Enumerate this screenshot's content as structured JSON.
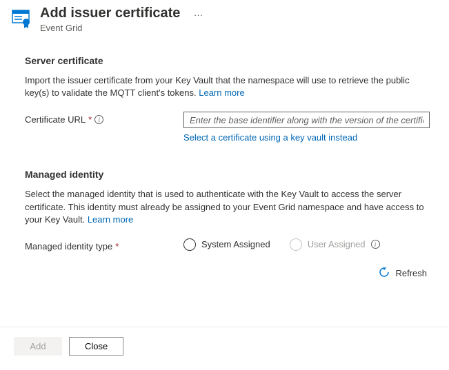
{
  "header": {
    "title": "Add issuer certificate",
    "subtitle": "Event Grid"
  },
  "serverCert": {
    "title": "Server certificate",
    "desc_part1": "Import the issuer certificate from your Key Vault that the namespace will use to retrieve the public key(s) to validate the MQTT client's tokens. ",
    "learn_more": "Learn more",
    "url_label": "Certificate URL",
    "url_placeholder": "Enter the base identifier along with the version of the certificate",
    "select_link": "Select a certificate using a key vault instead"
  },
  "managedIdentity": {
    "title": "Managed identity",
    "desc_part1": "Select the managed identity that is used to authenticate with the Key Vault to access the server certificate. This identity must already be assigned to your Event Grid namespace and have access to your Key Vault. ",
    "learn_more": "Learn more",
    "type_label": "Managed identity type",
    "option_system": "System Assigned",
    "option_user": "User Assigned"
  },
  "actions": {
    "refresh": "Refresh",
    "add": "Add",
    "close": "Close"
  }
}
